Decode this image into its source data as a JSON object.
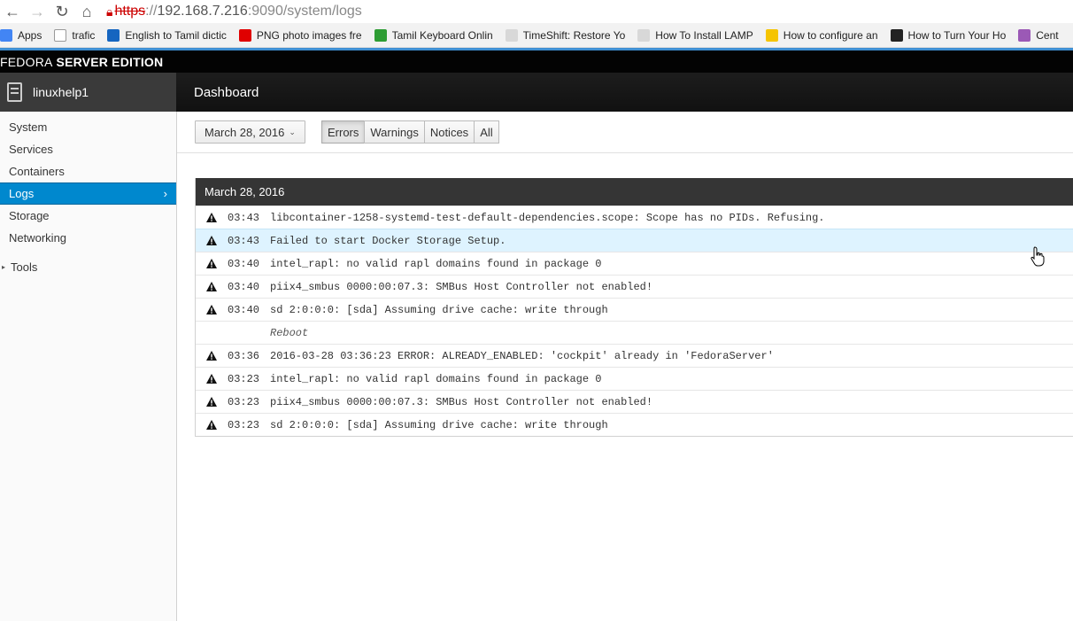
{
  "browser": {
    "url_scheme": "https",
    "url_host": "192.168.7.216",
    "url_rest": ":9090/system/logs",
    "bookmarks": [
      {
        "label": "Apps",
        "icon": "apps-grid-icon",
        "color": "#4285f4"
      },
      {
        "label": "trafic",
        "icon": "page-icon",
        "color": "#ffffff"
      },
      {
        "label": "English to Tamil dictic",
        "icon": "e-circle-icon",
        "color": "#1565c0"
      },
      {
        "label": "PNG photo images fre",
        "icon": "red-square-icon",
        "color": "#e00000"
      },
      {
        "label": "Tamil Keyboard Onlin",
        "icon": "green-l-icon",
        "color": "#2e9d34"
      },
      {
        "label": "TimeShift: Restore Yo",
        "icon": "folder-icon",
        "color": "#d8d8d8"
      },
      {
        "label": "How To Install LAMP",
        "icon": "folder-icon",
        "color": "#d8d8d8"
      },
      {
        "label": "How to configure an",
        "icon": "bulb-icon",
        "color": "#f5c400"
      },
      {
        "label": "How to Turn Your Ho",
        "icon": "htg-icon",
        "color": "#222222"
      },
      {
        "label": "Cent",
        "icon": "centos-icon",
        "color": "#9b59b6"
      }
    ]
  },
  "brand": {
    "light": "FEDORA",
    "bold": "SERVER EDITION"
  },
  "host": {
    "name": "linuxhelp1"
  },
  "topnav": {
    "title": "Dashboard"
  },
  "sidebar": {
    "items": [
      {
        "label": "System",
        "active": false
      },
      {
        "label": "Services",
        "active": false
      },
      {
        "label": "Containers",
        "active": false
      },
      {
        "label": "Logs",
        "active": true
      },
      {
        "label": "Storage",
        "active": false
      },
      {
        "label": "Networking",
        "active": false
      }
    ],
    "tools_label": "Tools"
  },
  "toolbar": {
    "date_label": "March 28, 2016",
    "priorities": [
      {
        "label": "Errors",
        "active": true
      },
      {
        "label": "Warnings",
        "active": false
      },
      {
        "label": "Notices",
        "active": false
      },
      {
        "label": "All",
        "active": false
      }
    ]
  },
  "logs": {
    "date_header": "March 28, 2016",
    "entries": [
      {
        "time": "03:43",
        "message": "libcontainer-1258-systemd-test-default-dependencies.scope: Scope has no PIDs. Refusing.",
        "type": "warning"
      },
      {
        "time": "03:43",
        "message": "Failed to start Docker Storage Setup.",
        "type": "warning",
        "highlight": true
      },
      {
        "time": "03:40",
        "message": "intel_rapl: no valid rapl domains found in package 0",
        "type": "warning"
      },
      {
        "time": "03:40",
        "message": "piix4_smbus 0000:00:07.3: SMBus Host Controller not enabled!",
        "type": "warning"
      },
      {
        "time": "03:40",
        "message": "sd 2:0:0:0: [sda] Assuming drive cache: write through",
        "type": "warning"
      },
      {
        "time": "",
        "message": "Reboot",
        "type": "reboot"
      },
      {
        "time": "03:36",
        "message": "2016-03-28 03:36:23 ERROR: ALREADY_ENABLED: 'cockpit' already in 'FedoraServer'",
        "type": "warning"
      },
      {
        "time": "03:23",
        "message": "intel_rapl: no valid rapl domains found in package 0",
        "type": "warning"
      },
      {
        "time": "03:23",
        "message": "piix4_smbus 0000:00:07.3: SMBus Host Controller not enabled!",
        "type": "warning"
      },
      {
        "time": "03:23",
        "message": "sd 2:0:0:0: [sda] Assuming drive cache: write through",
        "type": "warning"
      }
    ]
  }
}
